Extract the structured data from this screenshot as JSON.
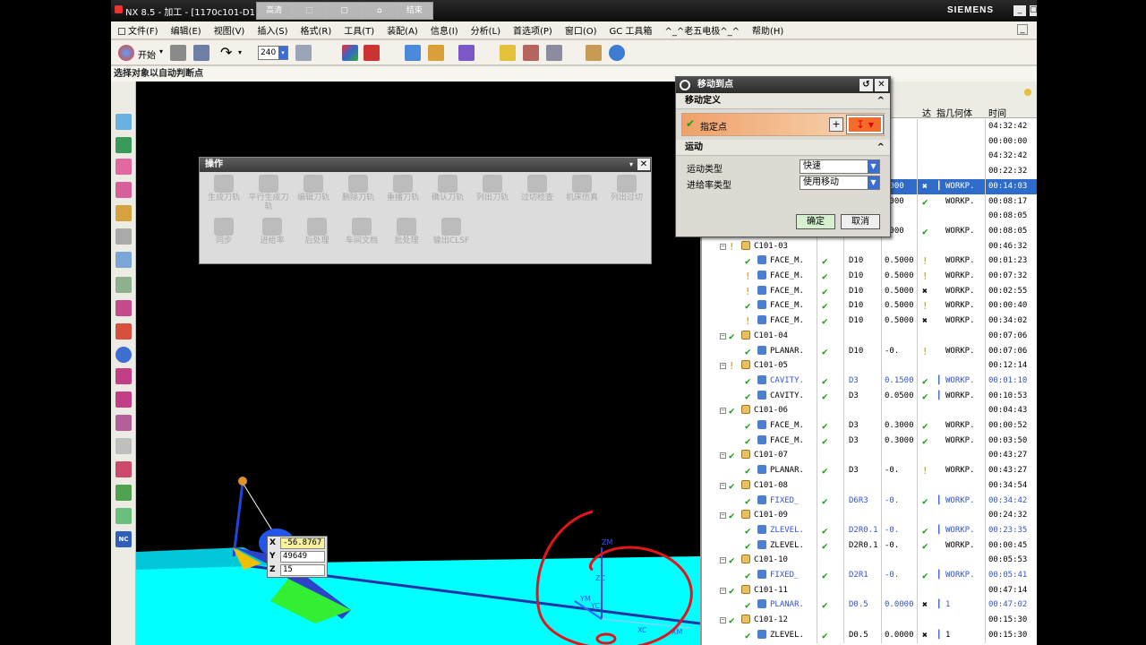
{
  "window": {
    "title": "NX 8.5 - 加工 - [1170c101-D1",
    "brand": "SIEMENS",
    "min_label": "_",
    "floatbar": [
      "高清",
      "",
      "",
      "",
      "结束"
    ]
  },
  "menu": {
    "items": [
      "文件(F)",
      "编辑(E)",
      "视图(V)",
      "插入(S)",
      "格式(R)",
      "工具(T)",
      "装配(A)",
      "信息(I)",
      "分析(L)",
      "首选项(P)",
      "窗口(O)",
      "GC 工具箱",
      "^_^老五电极^_^",
      "帮助(H)"
    ],
    "restore_label": "_"
  },
  "toolbar": {
    "start_label": "开始",
    "zoom_value": "240"
  },
  "cue_line": "选择对象以自动判断点",
  "operations_bar": {
    "title": "操作",
    "close": "✕",
    "dropdown": "▾",
    "row1": [
      "生成刀轨",
      "平行生成刀轨",
      "编辑刀轨",
      "删除刀轨",
      "重播刀轨",
      "确认刀轨",
      "列出刀轨",
      "过切检查",
      "机床仿真",
      "列出过切"
    ],
    "row2": [
      "同步",
      "进给率",
      "后处理",
      "车间文档",
      "批处理",
      "输出CLSF"
    ]
  },
  "dialog": {
    "title": "移动到点",
    "section1": "移动定义",
    "specify_point": "指定点",
    "section2": "运动",
    "motion_type_label": "运动类型",
    "motion_type_value": "快速",
    "feed_type_label": "进给率类型",
    "feed_type_value": "使用移动",
    "ok": "确定",
    "cancel": "取消",
    "caret": "^",
    "reset": "↺",
    "close": "✕"
  },
  "navigator": {
    "columns": {
      "qty": "量",
      "c1": "达",
      "c2": "指",
      "geom": "几何体",
      "time": "时间"
    },
    "rows": [
      {
        "name": "",
        "tool": "",
        "dep": "",
        "status": "",
        "toolpath": "",
        "geom": "",
        "time": "04:32:42"
      },
      {
        "name": "",
        "tool": "",
        "dep": "",
        "status": "",
        "toolpath": "",
        "geom": "",
        "time": "00:00:00"
      },
      {
        "name": "",
        "tool": "",
        "dep": "",
        "status": "",
        "toolpath": "",
        "geom": "",
        "time": "04:32:42"
      },
      {
        "name": "",
        "tool": "",
        "dep": "",
        "status": "",
        "toolpath": "",
        "geom": "",
        "time": "00:22:32"
      },
      {
        "name": "",
        "tool": "",
        "dep": "1000",
        "status": "x",
        "toolpath": "bar",
        "geom": "WORKP.",
        "time": "00:14:03",
        "selected": true
      },
      {
        "name": "",
        "tool": "",
        "dep": "1000",
        "status": "check",
        "toolpath": "",
        "geom": "WORKP.",
        "time": "00:08:17"
      },
      {
        "name": "",
        "tool": "",
        "dep": "",
        "status": "",
        "toolpath": "",
        "geom": "",
        "time": "00:08:05"
      },
      {
        "name": "",
        "tool": "",
        "dep": "0000",
        "status": "check",
        "toolpath": "",
        "geom": "WORKP.",
        "time": "00:08:05"
      },
      {
        "name": "C101-03",
        "group": true,
        "status_icon": "excl",
        "time": "00:46:32"
      },
      {
        "name": "FACE_M.",
        "tool": "D10",
        "dep": "0.5000",
        "status": "excl",
        "geom": "WORKP.",
        "time": "00:01:23",
        "op_status": "check"
      },
      {
        "name": "FACE_M.",
        "tool": "D10",
        "dep": "0.5000",
        "status": "excl",
        "geom": "WORKP.",
        "time": "00:07:32",
        "op_status": "excl"
      },
      {
        "name": "FACE_M.",
        "tool": "D10",
        "dep": "0.5000",
        "status": "x",
        "geom": "WORKP.",
        "time": "00:02:55",
        "op_status": "excl"
      },
      {
        "name": "FACE_M.",
        "tool": "D10",
        "dep": "0.5000",
        "status": "excl",
        "geom": "WORKP.",
        "time": "00:00:40",
        "op_status": "check"
      },
      {
        "name": "FACE_M.",
        "tool": "D10",
        "dep": "0.5000",
        "status": "x",
        "geom": "WORKP.",
        "time": "00:34:02",
        "op_status": "excl"
      },
      {
        "name": "C101-04",
        "group": true,
        "status_icon": "check",
        "time": "00:07:06"
      },
      {
        "name": "PLANAR.",
        "tool": "D10",
        "dep": "-0.",
        "status": "excl",
        "geom": "WORKP.",
        "time": "00:07:06",
        "op_status": "check"
      },
      {
        "name": "C101-05",
        "group": true,
        "status_icon": "excl",
        "time": "00:12:14"
      },
      {
        "name": "CAVITY.",
        "tool": "D3",
        "dep": "0.1500",
        "status": "check",
        "toolpath": "bar",
        "geom": "WORKP.",
        "time": "00:01:10",
        "op_status": "check",
        "blue": true
      },
      {
        "name": "CAVITY.",
        "tool": "D3",
        "dep": "0.0500",
        "status": "check",
        "toolpath": "bar",
        "geom": "WORKP.",
        "time": "00:10:53",
        "op_status": "check"
      },
      {
        "name": "C101-06",
        "group": true,
        "status_icon": "check",
        "time": "00:04:43"
      },
      {
        "name": "FACE_M.",
        "tool": "D3",
        "dep": "0.3000",
        "status": "check",
        "geom": "WORKP.",
        "time": "00:00:52",
        "op_status": "check"
      },
      {
        "name": "FACE_M.",
        "tool": "D3",
        "dep": "0.3000",
        "status": "check",
        "geom": "WORKP.",
        "time": "00:03:50",
        "op_status": "check"
      },
      {
        "name": "C101-07",
        "group": true,
        "status_icon": "check",
        "time": "00:43:27"
      },
      {
        "name": "PLANAR.",
        "tool": "D3",
        "dep": "-0.",
        "status": "excl",
        "geom": "WORKP.",
        "time": "00:43:27",
        "op_status": "check"
      },
      {
        "name": "C101-08",
        "group": true,
        "status_icon": "check",
        "time": "00:34:54"
      },
      {
        "name": "FIXED_",
        "tool": "D6R3",
        "dep": "-0.",
        "status": "check",
        "toolpath": "bar",
        "geom": "WORKP.",
        "time": "00:34:42",
        "op_status": "check",
        "blue": true
      },
      {
        "name": "C101-09",
        "group": true,
        "status_icon": "check",
        "time": "00:24:32"
      },
      {
        "name": "ZLEVEL.",
        "tool": "D2R0.1",
        "dep": "-0.",
        "status": "check",
        "toolpath": "bar",
        "geom": "WORKP.",
        "time": "00:23:35",
        "op_status": "check",
        "blue": true
      },
      {
        "name": "ZLEVEL.",
        "tool": "D2R0.1",
        "dep": "-0.",
        "status": "check",
        "geom": "WORKP.",
        "time": "00:00:45",
        "op_status": "check"
      },
      {
        "name": "C101-10",
        "group": true,
        "status_icon": "check",
        "time": "00:05:53"
      },
      {
        "name": "FIXED_",
        "tool": "D2R1",
        "dep": "-0.",
        "status": "check",
        "toolpath": "bar",
        "geom": "WORKP.",
        "time": "00:05:41",
        "op_status": "check",
        "blue": true
      },
      {
        "name": "C101-11",
        "group": true,
        "status_icon": "check",
        "time": "00:47:14"
      },
      {
        "name": "PLANAR.",
        "tool": "D0.5",
        "dep": "0.0000",
        "status": "x",
        "toolpath": "bar",
        "geom": "1",
        "time": "00:47:02",
        "op_status": "check",
        "blue": true
      },
      {
        "name": "C101-12",
        "group": true,
        "status_icon": "check",
        "time": "00:15:30"
      },
      {
        "name": "ZLEVEL.",
        "tool": "D0.5",
        "dep": "0.0000",
        "status": "x",
        "toolpath": "bar",
        "geom": "1",
        "time": "00:15:30",
        "op_status": "check"
      }
    ]
  },
  "coord_tooltip": {
    "x_label": "X",
    "x_value": "-56.8767",
    "y_label": "Y",
    "y_value": "49649",
    "z_label": "Z",
    "z_value": "15"
  },
  "viewport_labels": {
    "zm": "ZM",
    "zc": "ZC",
    "ym": "YM",
    "yc": "YC",
    "xc": "XC",
    "xm": "XM"
  },
  "colors": {
    "cyan_part": "#00ffff",
    "annotation_red": "#e0161c",
    "selection_blue": "#2f6bc8",
    "check_green": "#1aa01a",
    "warn_yellow": "#e0b000"
  }
}
